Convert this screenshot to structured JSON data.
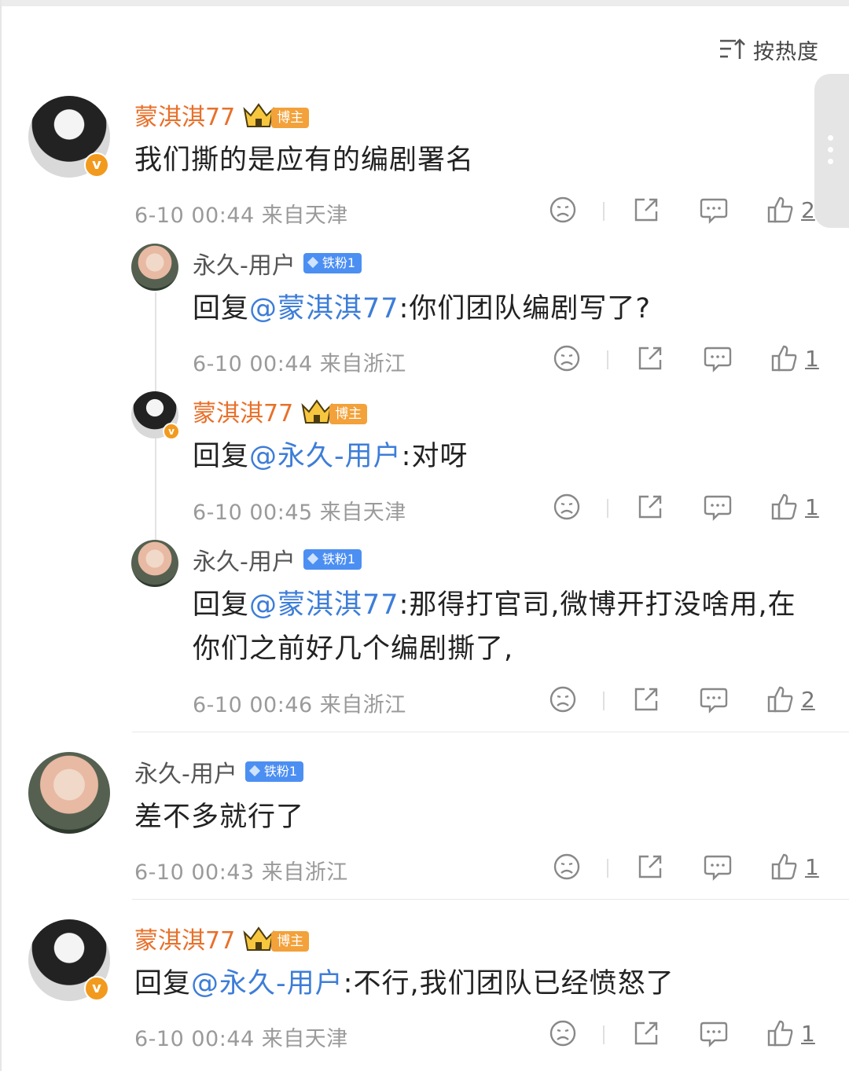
{
  "sort": {
    "label": "按热度"
  },
  "comments": [
    {
      "user": "蒙淇淇77",
      "badge": "博主",
      "text": "我们撕的是应有的编剧署名",
      "meta": "6-10 00:44  来自天津",
      "likes": "2"
    },
    {
      "user": "永久-用户",
      "badge": "铁粉1",
      "reply_prefix": "回复",
      "mention": "@蒙淇淇77",
      "text": ":你们团队编剧写了?",
      "meta": "6-10 00:44  来自浙江",
      "likes": "1"
    },
    {
      "user": "蒙淇淇77",
      "badge": "博主",
      "reply_prefix": "回复",
      "mention": "@永久-用户",
      "text": ":对呀",
      "meta": "6-10 00:45  来自天津",
      "likes": "1"
    },
    {
      "user": "永久-用户",
      "badge": "铁粉1",
      "reply_prefix": "回复",
      "mention": "@蒙淇淇77",
      "text": ":那得打官司,微博开打没啥用,在你们之前好几个编剧撕了,",
      "meta": "6-10 00:46  来自浙江",
      "likes": "2"
    },
    {
      "user": "永久-用户",
      "badge": "铁粉1",
      "text": "差不多就行了",
      "meta": "6-10 00:43  来自浙江",
      "likes": "1"
    },
    {
      "user": "蒙淇淇77",
      "badge": "博主",
      "reply_prefix": "回复",
      "mention": "@永久-用户",
      "text": ":不行,我们团队已经愤怒了",
      "meta": "6-10 00:44  来自天津",
      "likes": "1"
    }
  ]
}
